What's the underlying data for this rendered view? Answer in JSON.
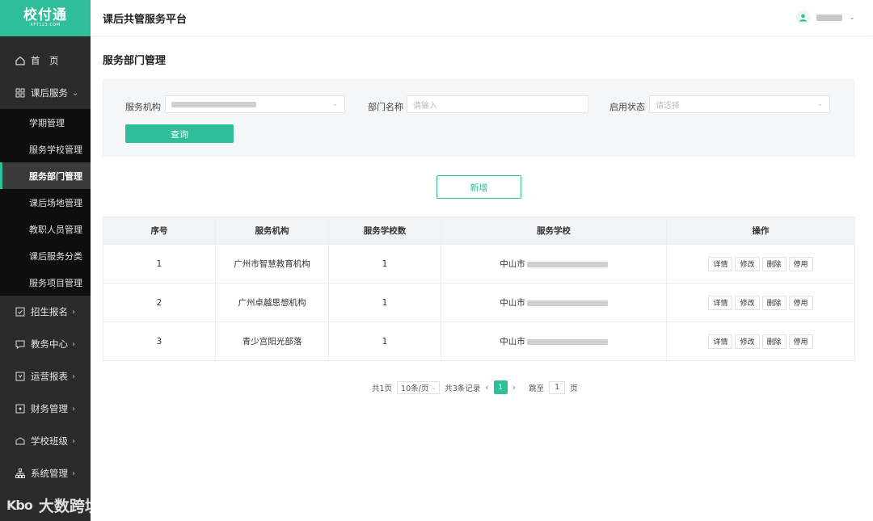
{
  "logo": {
    "mark": "校付通",
    "sub": "XFT123.COM"
  },
  "header": {
    "title": "课后共管服务平台"
  },
  "nav": {
    "home": "首　页",
    "after_school": "课后服务",
    "sub_items": [
      "学期管理",
      "服务学校管理",
      "服务部门管理",
      "课后场地管理",
      "教职人员管理",
      "课后服务分类",
      "服务项目管理"
    ],
    "enroll": "招生报名",
    "teaching": "教务中心",
    "reports": "运营报表",
    "finance": "财务管理",
    "classes": "学校班级",
    "system": "系统管理"
  },
  "page": {
    "title": "服务部门管理"
  },
  "filter": {
    "org_label": "服务机构",
    "dept_label": "部门名称",
    "dept_placeholder": "请输入",
    "status_label": "启用状态",
    "status_placeholder": "请选择",
    "query_label": "查询"
  },
  "add_label": "新增",
  "table": {
    "headers": [
      "序号",
      "服务机构",
      "服务学校数",
      "服务学校",
      "操作"
    ],
    "rows": [
      {
        "no": "1",
        "org": "广州市智慧教育机构",
        "count": "1",
        "school": "中山市"
      },
      {
        "no": "2",
        "org": "广州卓越思想机构",
        "count": "1",
        "school": "中山市"
      },
      {
        "no": "3",
        "org": "青少宫阳光部落",
        "count": "1",
        "school": "中山市"
      }
    ],
    "ops": [
      "详情",
      "修改",
      "删除",
      "停用"
    ]
  },
  "pager": {
    "total_pages": "共1页",
    "page_size": "10条/页",
    "total_records": "共3条记录",
    "current": "1",
    "jump_label": "跳至",
    "jump_value": "1",
    "page_suffix": "页"
  },
  "watermark": {
    "logo": "Kbo",
    "text": "大数跨境"
  },
  "colors": {
    "accent": "#2fbe9a",
    "sidebar": "#2b2b2b"
  }
}
